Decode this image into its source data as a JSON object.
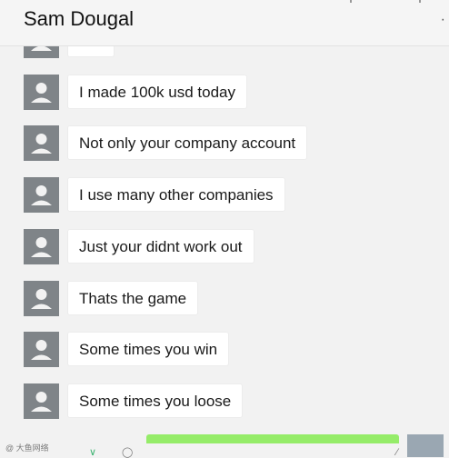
{
  "header": {
    "title": "Sam Dougal",
    "more_icon": "ellipsis-icon"
  },
  "messages": [
    {
      "text": ""
    },
    {
      "text": "I made 100k usd today"
    },
    {
      "text": "Not only your company account"
    },
    {
      "text": "I use many other companies"
    },
    {
      "text": "Just your didnt work out"
    },
    {
      "text": "Thats the game"
    },
    {
      "text": "Some times you win"
    },
    {
      "text": "Some times you loose"
    }
  ],
  "colors": {
    "background": "#f2f2f2",
    "bubble_incoming": "#ffffff",
    "bubble_outgoing": "#95ec69",
    "avatar": "#7f8488"
  },
  "watermark": {
    "text": "@ 大鱼网络"
  }
}
